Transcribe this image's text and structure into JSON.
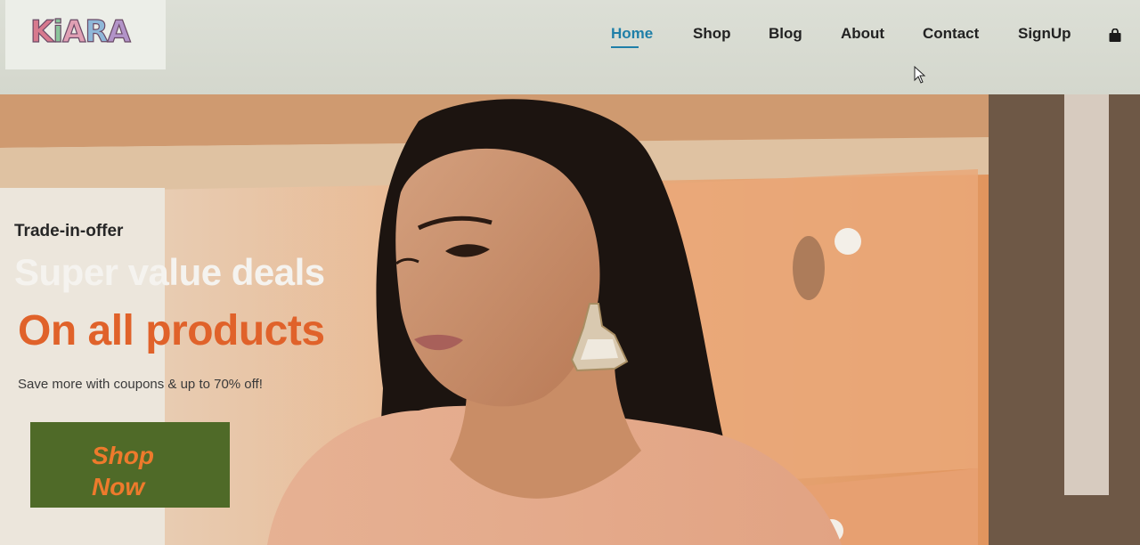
{
  "logo": {
    "letters": [
      {
        "ch": "K",
        "color": "#d77a8e"
      },
      {
        "ch": "i",
        "color": "#8ac49b"
      },
      {
        "ch": "A",
        "color": "#e0a0b4"
      },
      {
        "ch": "R",
        "color": "#8fb7d8"
      },
      {
        "ch": "A",
        "color": "#b293c8"
      }
    ]
  },
  "nav": {
    "items": [
      "Home",
      "Shop",
      "Blog",
      "About",
      "Contact",
      "SignUp"
    ],
    "active": "Home",
    "cart_icon": "shopping-bag-icon"
  },
  "hero": {
    "tagline": "Trade-in-offer",
    "headline": "Super value deals",
    "subheadline": "On all products",
    "description": "Save more with coupons & up to 70% off!",
    "cta_label": "Shop\nNow"
  },
  "colors": {
    "accent_orange": "#e0622a",
    "nav_active": "#1f7fa8",
    "cta_bg": "#4f6a28"
  }
}
